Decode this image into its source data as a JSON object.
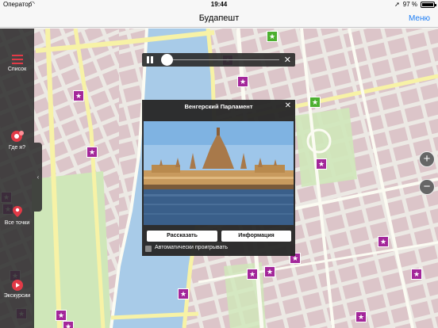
{
  "status_bar": {
    "carrier": "Оператор",
    "time": "19:44",
    "battery": "97 %"
  },
  "nav": {
    "title": "Будапешт",
    "menu_label": "Меню"
  },
  "sidebar": {
    "items": [
      {
        "label": "Список",
        "icon": "list-icon"
      },
      {
        "label": "Где я?",
        "icon": "location-target-icon"
      },
      {
        "label": "Все точки",
        "icon": "all-points-icon"
      },
      {
        "label": "Экскурсии",
        "icon": "tours-icon"
      }
    ],
    "handle_glyph": "‹"
  },
  "player": {
    "close_glyph": "✕"
  },
  "popup": {
    "title": "Венгерский Парламент",
    "close_glyph": "✕",
    "button_tell": "Рассказать",
    "button_info": "Информация",
    "autoplay_label": "Автоматически проигрывать",
    "photo_subject": "parliament-photo"
  },
  "zoom": {
    "in": "+",
    "out": "−"
  },
  "colors": {
    "accent": "#1a7cf5",
    "poi_purple": "#a3279a",
    "poi_green": "#4caf2f",
    "river": "#a8cbe8",
    "map_bg": "#ece9e4",
    "block": "#dcc5c9",
    "park": "#cfe7b9",
    "road_yellow": "#f7f2a6"
  }
}
